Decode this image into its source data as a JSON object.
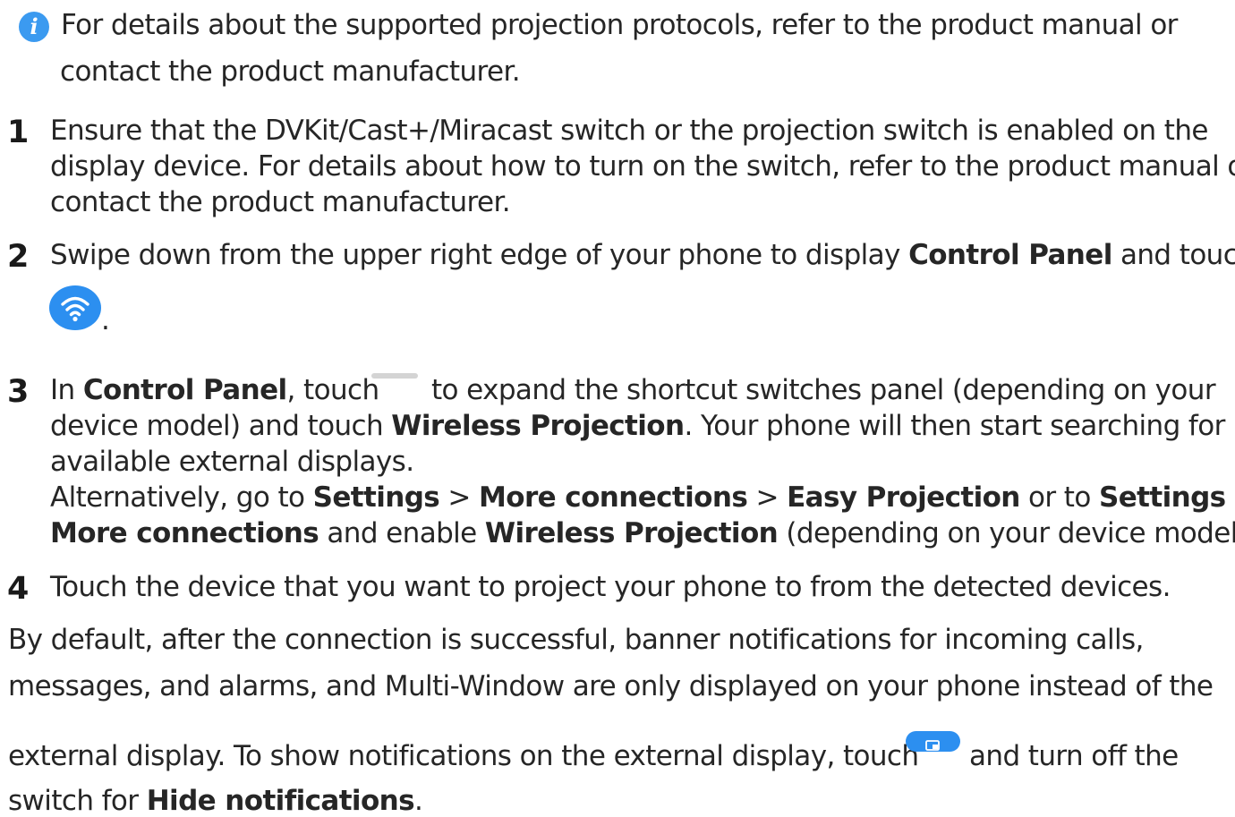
{
  "note": {
    "line1": "For details about the supported projection protocols, refer to the product manual or",
    "line2": "contact the product manufacturer."
  },
  "icons": {
    "info": "info-icon",
    "info_glyph": "i",
    "wifi": "wifi-icon",
    "expand_bar": "expand-bar-icon",
    "projection": "projection-settings-icon"
  },
  "colors": {
    "accent": "#2c8ff0",
    "text": "#262626"
  },
  "steps": [
    {
      "num": "1",
      "lines": [
        "Ensure that the DVKit/Cast+/Miracast switch or the projection switch is enabled on the",
        "display device. For details about how to turn on the switch, refer to the product manual or",
        "contact the product manufacturer."
      ]
    },
    {
      "num": "2",
      "t1": "Swipe down from the upper right edge of your phone to display ",
      "b1": "Control Panel",
      "t2": " and touch",
      "t3": "."
    },
    {
      "num": "3",
      "l1_t1": "In ",
      "l1_b1": "Control Panel",
      "l1_t2": ", touch",
      "l1_t3": "to expand the shortcut switches panel (depending on your",
      "l2_t1": "device model) and touch ",
      "l2_b1": "Wireless Projection",
      "l2_t2": ". Your phone will then start searching for",
      "l3": "available external displays.",
      "l4_t1": "Alternatively, go to ",
      "l4_b1": "Settings",
      "l4_t2": " > ",
      "l4_b2": "More connections",
      "l4_t3": " > ",
      "l4_b3": "Easy Projection",
      "l4_t4": " or to ",
      "l4_b4": "Settings",
      "l4_t5": " >",
      "l5_b1": "More connections",
      "l5_t1": " and enable ",
      "l5_b2": "Wireless Projection",
      "l5_t2": " (depending on your device model)."
    },
    {
      "num": "4",
      "text": "Touch the device that you want to project your phone to from the detected devices."
    }
  ],
  "footer": {
    "line1": "By default, after the connection is successful, banner notifications for incoming calls,",
    "line2": "messages, and alarms, and Multi-Window are only displayed on your phone instead of the",
    "line3_t1": "external display. To show notifications on the external display, touch",
    "line3_t2": "and turn off the",
    "line4_t1": "switch for ",
    "line4_b1": "Hide notifications",
    "line4_t2": "."
  }
}
